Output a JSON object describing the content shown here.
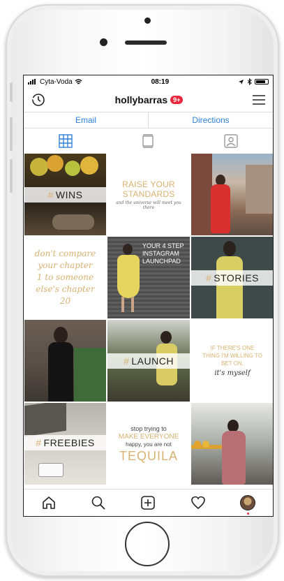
{
  "status": {
    "carrier": "Cyta-Voda",
    "time": "08:19"
  },
  "profile": {
    "username": "hollybarras",
    "notifications": "9+"
  },
  "links": {
    "email": "Email",
    "directions": "Directions"
  },
  "grid": {
    "wins": "WINS",
    "raise_title": "RAISE YOUR STANDARDS",
    "raise_sub": "and the universe will meet you there",
    "dont_compare": "don't compare your chapter 1 to someone else's chapter 20",
    "launchpad": "YOUR 4 STEP INSTAGRAM LAUNCHPAD",
    "stories": "STORIES",
    "launch": "LAUNCH",
    "one_thing": "IF THERE'S ONE THING I'M WILLING TO BET ON,",
    "myself": "it's myself",
    "freebies": "FREEBIES",
    "tequila_line1": "stop trying to",
    "tequila_line2": "MAKE EVERYONE",
    "tequila_line3": "happy, you are not",
    "tequila_line4": "TEQUILA"
  },
  "colors": {
    "accent": "#d8b272",
    "link": "#2f7fd7",
    "badge": "#e8283c"
  }
}
